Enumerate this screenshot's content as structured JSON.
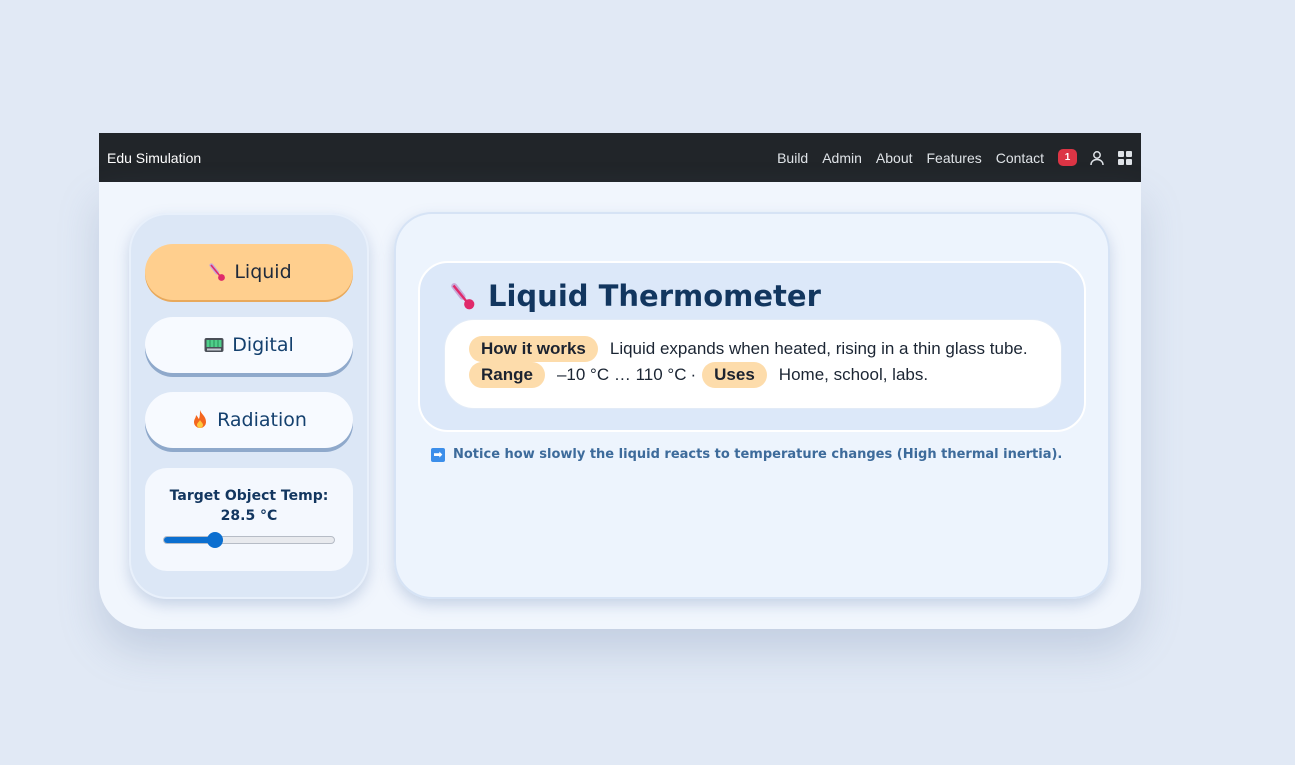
{
  "navbar": {
    "brand": "Edu Simulation",
    "links": [
      "Build",
      "Admin",
      "About",
      "Features",
      "Contact"
    ],
    "notification_count": "1",
    "icons": [
      "user-icon",
      "grid-icon"
    ]
  },
  "sidebar": {
    "modes": [
      {
        "label": "Liquid",
        "icon": "thermometer-icon",
        "active": true
      },
      {
        "label": "Digital",
        "icon": "digital-display-icon",
        "active": false
      },
      {
        "label": "Radiation",
        "icon": "fire-icon",
        "active": false
      }
    ],
    "temp": {
      "label": "Target Object Temp:",
      "value": "28.5 °C",
      "slider_fraction": 0.3
    }
  },
  "main": {
    "title": "Liquid Thermometer",
    "title_icon": "thermometer-icon",
    "how_label": "How it works",
    "how_text": "Liquid expands when heated, rising in a thin glass tube.",
    "range_label": "Range",
    "range_text": "–10 °C … 110 °C",
    "separator": "·",
    "uses_label": "Uses",
    "uses_text": "Home, school, labs.",
    "notice": "Notice how slowly the liquid reacts to temperature changes (High thermal inertia).",
    "notice_icon": "arrow-right-icon"
  },
  "colors": {
    "navbar_bg": "#212529",
    "active_mode": "#ffcf8e",
    "pill": "#fddcab",
    "accent": "#0b6fd0",
    "badge": "#dc3545"
  }
}
